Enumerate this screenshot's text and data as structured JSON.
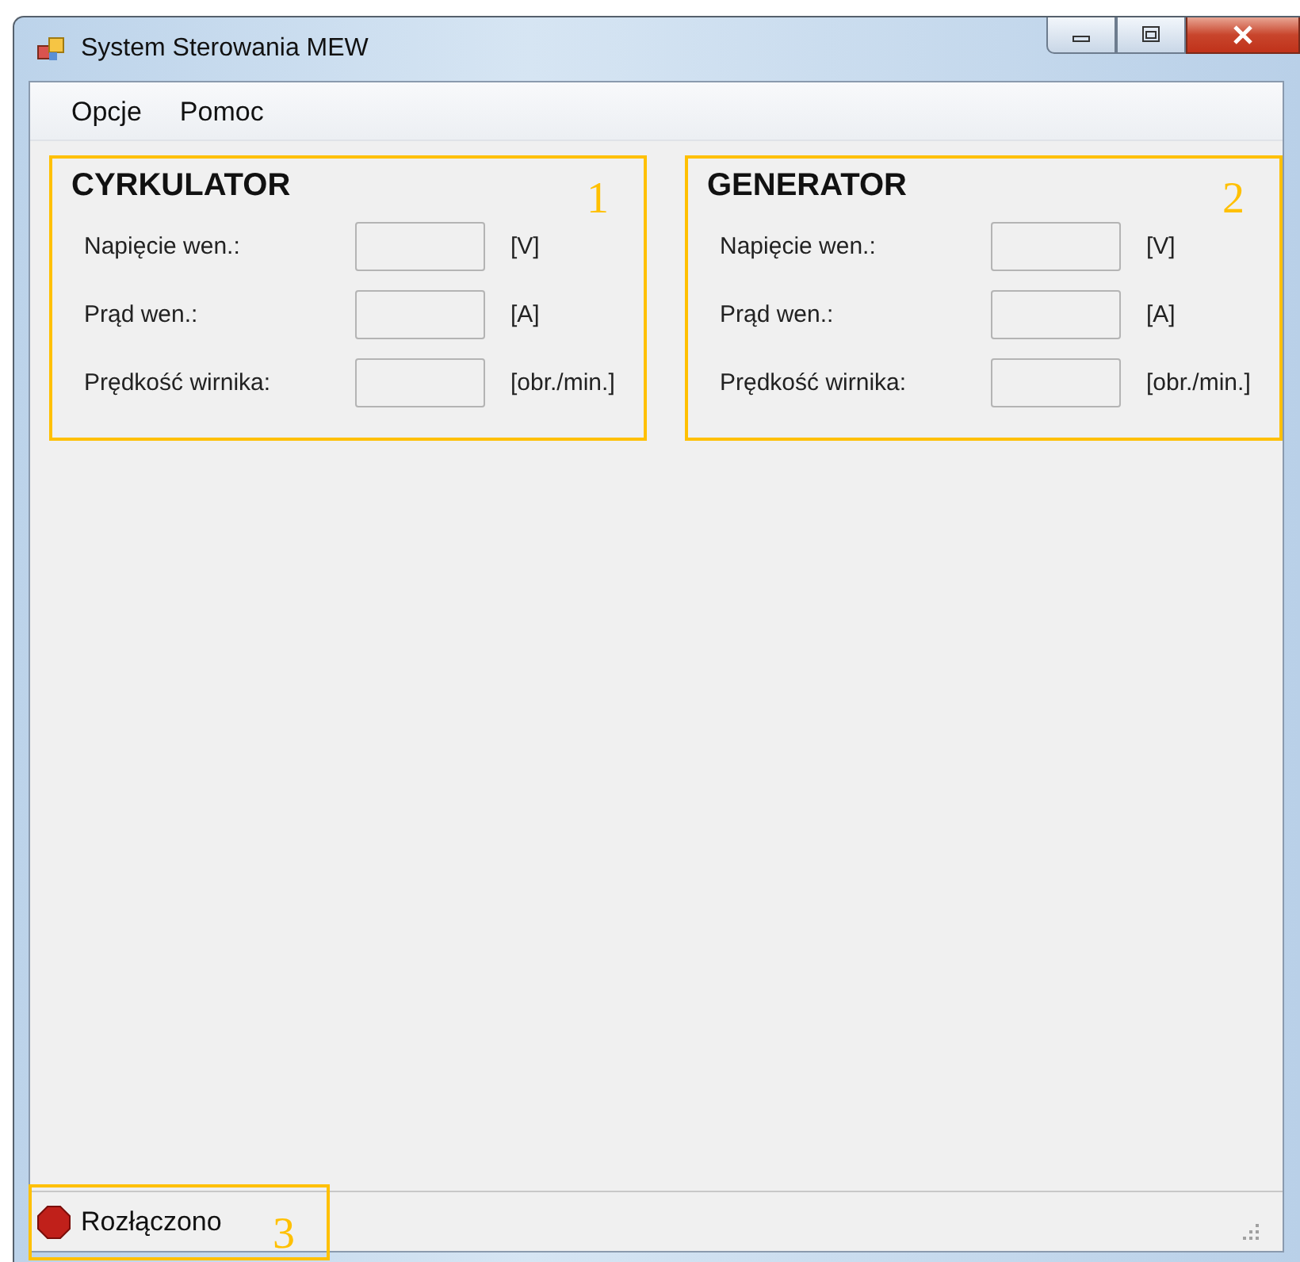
{
  "window": {
    "title": "System Sterowania MEW"
  },
  "menu": [
    {
      "label": "Opcje"
    },
    {
      "label": "Pomoc"
    }
  ],
  "panels": [
    {
      "title": "CYRKULATOR",
      "callout": "1",
      "fields": [
        {
          "label": "Napięcie wen.:",
          "unit": "[V]"
        },
        {
          "label": "Prąd wen.:",
          "unit": "[A]"
        },
        {
          "label": "Prędkość wirnika:",
          "unit": "[obr./min.]"
        }
      ]
    },
    {
      "title": "GENERATOR",
      "callout": "2",
      "fields": [
        {
          "label": "Napięcie wen.:",
          "unit": "[V]"
        },
        {
          "label": "Prąd wen.:",
          "unit": "[A]"
        },
        {
          "label": "Prędkość wirnika:",
          "unit": "[obr./min.]"
        }
      ]
    }
  ],
  "status_bar": {
    "text": "Rozłączono",
    "connected": false,
    "callout": "3"
  }
}
